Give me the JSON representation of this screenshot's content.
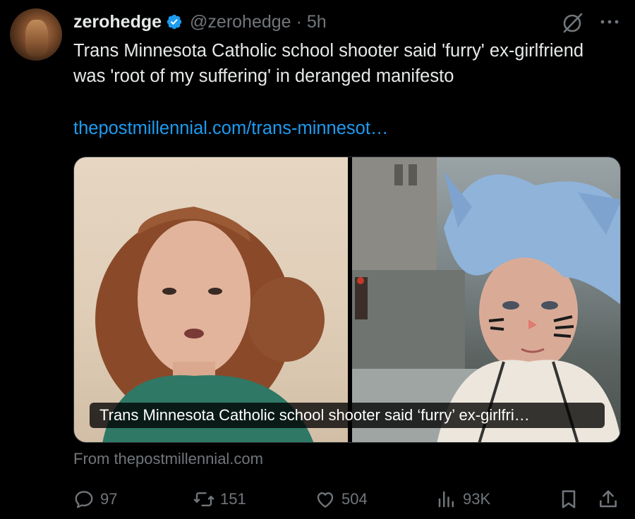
{
  "tweet": {
    "author_name": "zerohedge",
    "handle": "@zerohedge",
    "separator": "·",
    "time": "5h",
    "text": "Trans Minnesota Catholic school shooter said 'furry' ex-girlfriend was 'root of my suffering' in deranged manifesto",
    "link_text": "thepostmillennial.com/trans-minnesot…"
  },
  "card": {
    "caption": "Trans Minnesota Catholic school shooter said ‘furry’ ex-girlfri…",
    "source": "From thepostmillennial.com"
  },
  "actions": {
    "replies": "97",
    "reposts": "151",
    "likes": "504",
    "views": "93K"
  },
  "colors": {
    "background": "#000000",
    "text": "#e7e9ea",
    "muted": "#71767b",
    "link": "#1d9bf0",
    "verified": "#1d9bf0"
  },
  "icons": [
    "verified-badge-icon",
    "grok-icon",
    "more-icon",
    "reply-icon",
    "repost-icon",
    "like-icon",
    "views-icon",
    "bookmark-icon",
    "share-icon"
  ]
}
